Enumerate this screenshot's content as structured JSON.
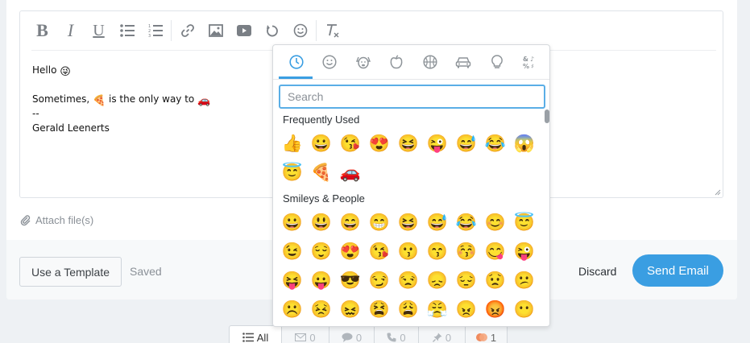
{
  "editor": {
    "toolbar": [
      {
        "name": "bold-button",
        "glyph": "B"
      },
      {
        "name": "italic-button",
        "glyph": "I"
      },
      {
        "name": "underline-button",
        "glyph": "U"
      }
    ],
    "body_lines": [
      {
        "text": "Hello",
        "emoji": "😜"
      },
      {
        "text": "",
        "emoji": ""
      },
      {
        "text": "Sometimes, ",
        "emoji": "🍕",
        "text2": " is the only way to ",
        "emoji2": "🚗"
      },
      {
        "text": "--",
        "emoji": ""
      },
      {
        "text": "Gerald Leenerts",
        "emoji": ""
      }
    ]
  },
  "attach": {
    "label": "Attach file(s)"
  },
  "footer": {
    "template_label": "Use a Template",
    "saved_label": "Saved",
    "discard_label": "Discard",
    "send_label": "Send Email"
  },
  "tabs": [
    {
      "label": "All",
      "icon": "list-icon",
      "active": true
    },
    {
      "label": "0",
      "icon": "mail-icon",
      "active": false
    },
    {
      "label": "0",
      "icon": "chat-icon",
      "active": false
    },
    {
      "label": "0",
      "icon": "phone-icon",
      "active": false
    },
    {
      "label": "0",
      "icon": "pin-icon",
      "active": false
    },
    {
      "label": "1",
      "icon": "activity-icon",
      "active": false
    }
  ],
  "picker": {
    "categories": [
      "recent-icon",
      "smiley-icon",
      "animal-icon",
      "food-icon",
      "sports-icon",
      "car-icon",
      "lightbulb-icon",
      "symbols-icon"
    ],
    "search_placeholder": "Search",
    "frequently_used": {
      "title": "Frequently Used",
      "emojis": [
        "👍",
        "😀",
        "😘",
        "😍",
        "😆",
        "😜",
        "😅",
        "😂",
        "😱",
        "😇",
        "🍕",
        "🚗"
      ]
    },
    "smileys": {
      "title": "Smileys & People",
      "emojis": [
        "😀",
        "😃",
        "😄",
        "😁",
        "😆",
        "😅",
        "😂",
        "😊",
        "😇",
        "😉",
        "😌",
        "😍",
        "😘",
        "😗",
        "😙",
        "😚",
        "😋",
        "😜",
        "😝",
        "😛",
        "😎",
        "😏",
        "😒",
        "😞",
        "😔",
        "😟",
        "😕",
        "☹️",
        "😣",
        "😖",
        "😫",
        "😩",
        "😤",
        "😠",
        "😡",
        "😶"
      ]
    }
  },
  "colors": {
    "accent": "#3a9ee2",
    "icon_gray": "#7a7f85"
  }
}
